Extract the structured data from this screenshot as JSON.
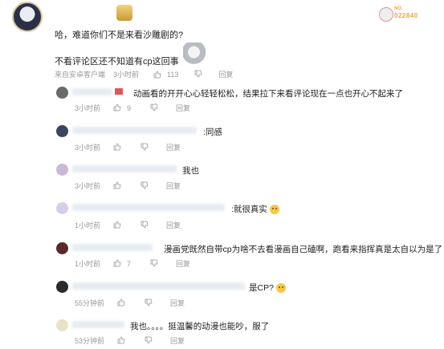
{
  "main_comment": {
    "badge_no": "NO.",
    "badge_num": "022840",
    "line1": "哈，难道你们不是来看沙雕剧的?",
    "line2": "不看评论区还不知道有cp这回事",
    "meta": {
      "device": "来自安卓客户端",
      "time": "3小时前",
      "likes": "113",
      "reply": "回复"
    }
  },
  "replies": [
    {
      "text": "动画看的开开心心轻轻松松，结果拉下来看评论现在一点也开心不起来了",
      "time": "3小时前",
      "likes": "9",
      "reply": "回复"
    },
    {
      "text": ":同感",
      "time": "3小时前",
      "likes": "",
      "reply": "回复"
    },
    {
      "text": "我也",
      "time": "3小时前",
      "likes": "",
      "reply": "回复"
    },
    {
      "text": ":就很真实",
      "time": "1小时前",
      "likes": "",
      "reply": "回复"
    },
    {
      "text": "漫画党既然自带cp为啥不去看漫画自己磕啊，跑看来指挥真是太自以为是了",
      "time": "1小时前",
      "likes": "7",
      "reply": "回复"
    },
    {
      "text": "是CP?",
      "time": "55分钟前",
      "likes": "",
      "reply": "回复"
    },
    {
      "text": "我也。。。。挺温馨的动漫也能吵，服了",
      "time": "53分钟前",
      "likes": "",
      "reply": "回复"
    }
  ],
  "colors": {
    "meta": "#999999",
    "text": "#222222",
    "badge_accent": "#e7a84a"
  }
}
